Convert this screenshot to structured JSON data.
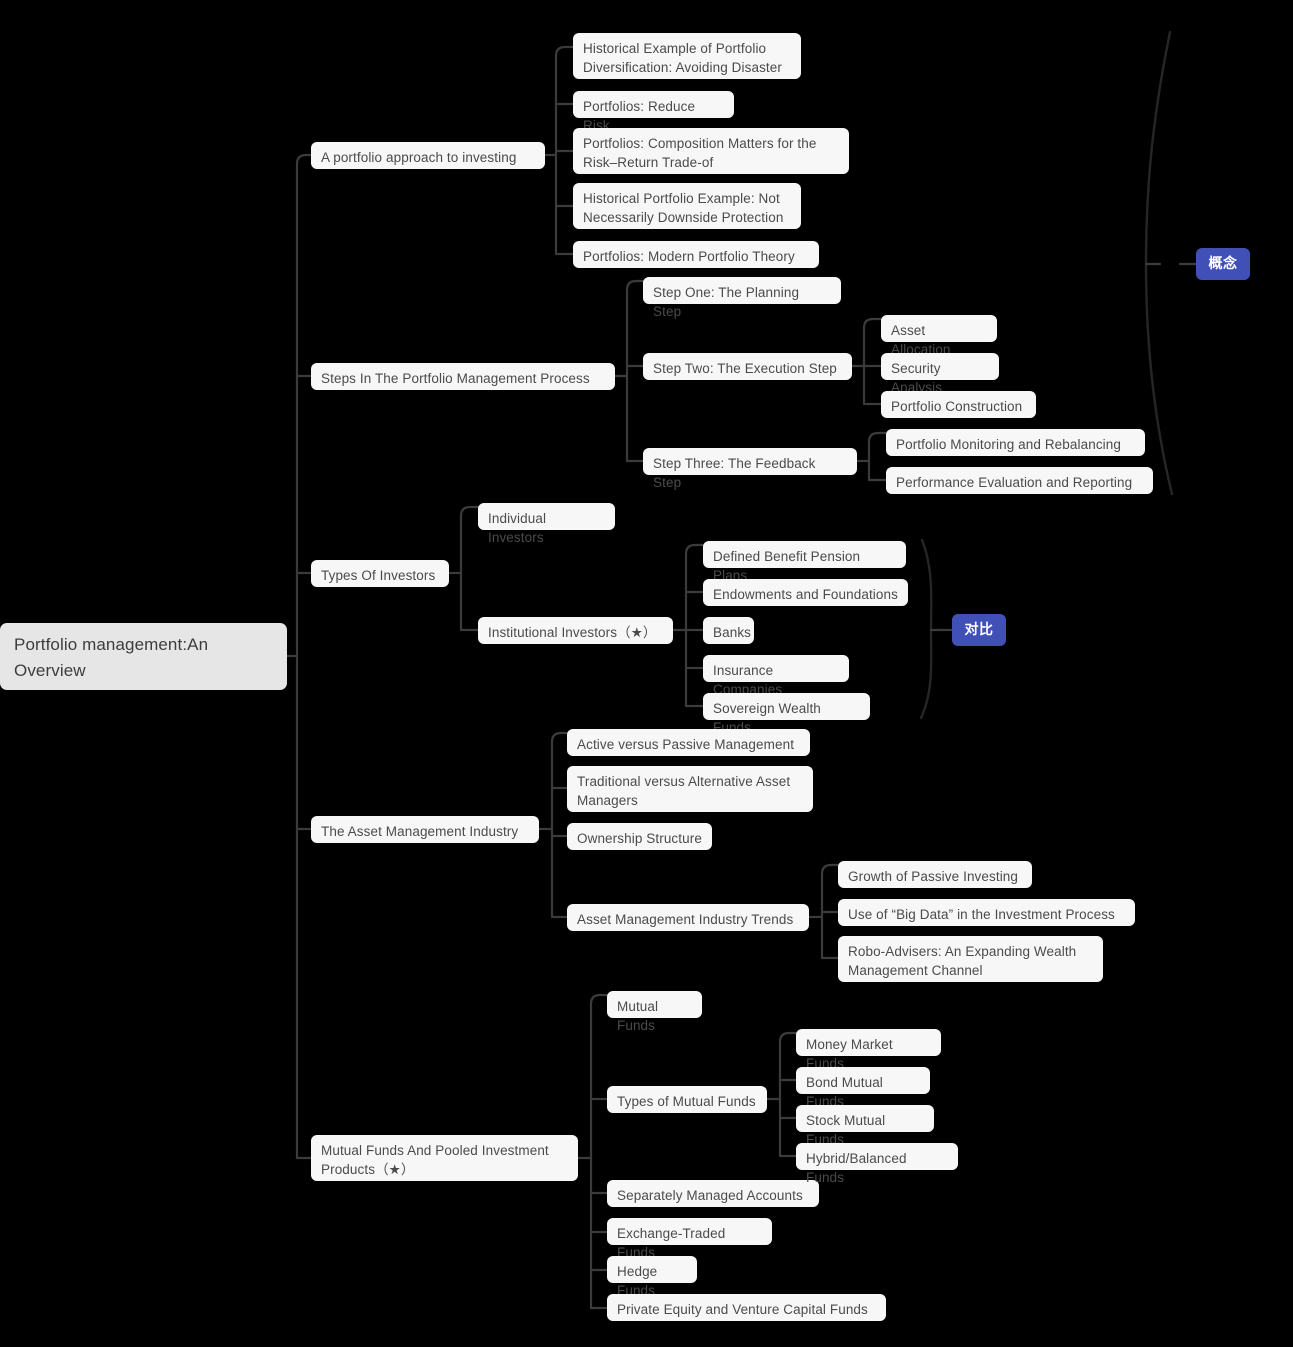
{
  "meta": {
    "title": "Portfolio management:An Overview",
    "canvas_bg": "#000000",
    "node_bg": "#f7f7f7",
    "root_bg": "#e6e6e6",
    "node_text": "#4b4b4b",
    "link_color": "#3b3b3b",
    "badge_bg": "#4050b7",
    "badge_text": "#ffffff"
  },
  "root": {
    "label": "Portfolio management:An\nOverview"
  },
  "badges": [
    {
      "label": "概念",
      "groups": "A portfolio approach to investing / Steps In The Portfolio Management Process"
    },
    {
      "label": "对比",
      "groups": "Institutional Investors sub-types"
    }
  ],
  "branches": [
    {
      "label": "A portfolio approach to investing",
      "children": [
        {
          "label": "Historical Example of Portfolio\nDiversification: Avoiding Disaster"
        },
        {
          "label": "Portfolios: Reduce Risk"
        },
        {
          "label": "Portfolios: Composition Matters for the\nRisk–Return Trade-of"
        },
        {
          "label": "Historical Portfolio Example: Not\nNecessarily Downside Protection"
        },
        {
          "label": "Portfolios: Modern Portfolio Theory"
        }
      ]
    },
    {
      "label": "Steps In The Portfolio Management Process",
      "children": [
        {
          "label": "Step One: The Planning Step",
          "children": []
        },
        {
          "label": "Step Two: The Execution Step",
          "children": [
            {
              "label": "Asset Allocation"
            },
            {
              "label": "Security Analysis"
            },
            {
              "label": "Portfolio Construction"
            }
          ]
        },
        {
          "label": "Step Three: The Feedback Step",
          "children": [
            {
              "label": "Portfolio Monitoring and Rebalancing"
            },
            {
              "label": "Performance Evaluation and Reporting"
            }
          ]
        }
      ]
    },
    {
      "label": "Types Of Investors",
      "children": [
        {
          "label": "Individual Investors",
          "children": []
        },
        {
          "label": "Institutional Investors（★）",
          "children": [
            {
              "label": "Defined Benefit Pension Plans"
            },
            {
              "label": "Endowments and Foundations"
            },
            {
              "label": "Banks"
            },
            {
              "label": "Insurance Companies"
            },
            {
              "label": "Sovereign Wealth Funds"
            }
          ]
        }
      ]
    },
    {
      "label": "The Asset Management Industry",
      "children": [
        {
          "label": "Active versus Passive Management",
          "children": []
        },
        {
          "label": "Traditional versus Alternative Asset\nManagers",
          "children": []
        },
        {
          "label": "Ownership Structure",
          "children": []
        },
        {
          "label": "Asset Management Industry Trends",
          "children": [
            {
              "label": "Growth of Passive Investing"
            },
            {
              "label": "Use of “Big Data” in the Investment Process"
            },
            {
              "label": "Robo-Advisers: An Expanding Wealth\nManagement Channel"
            }
          ]
        }
      ]
    },
    {
      "label": "Mutual Funds And Pooled Investment\nProducts（★）",
      "children": [
        {
          "label": "Mutual Funds",
          "children": []
        },
        {
          "label": "Types of Mutual Funds",
          "children": [
            {
              "label": "Money Market Funds"
            },
            {
              "label": "Bond Mutual Funds"
            },
            {
              "label": "Stock Mutual Funds"
            },
            {
              "label": "Hybrid/Balanced Funds"
            }
          ]
        },
        {
          "label": "Separately Managed Accounts",
          "children": []
        },
        {
          "label": "Exchange-Traded Funds",
          "children": []
        },
        {
          "label": "Hedge Funds",
          "children": []
        },
        {
          "label": "Private Equity and Venture Capital Funds",
          "children": []
        }
      ]
    }
  ]
}
